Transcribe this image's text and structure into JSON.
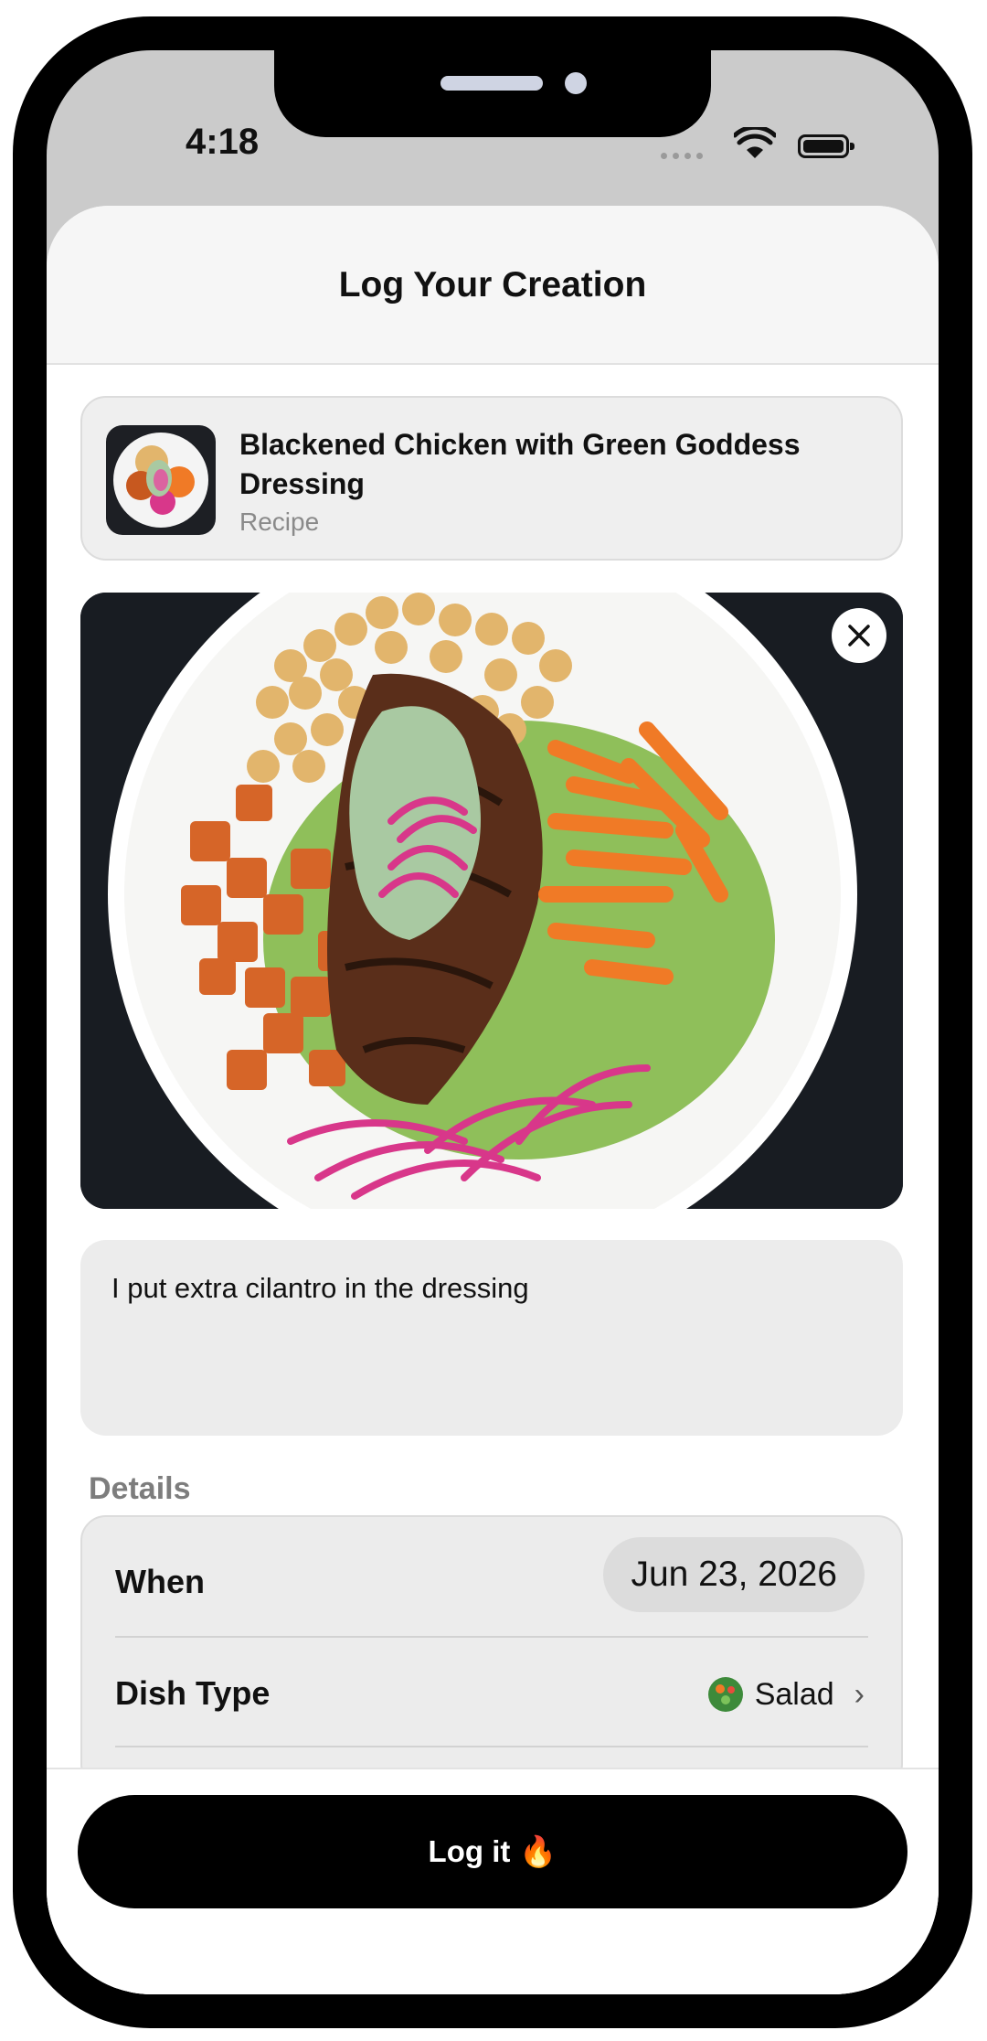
{
  "status_bar": {
    "time": "4:18"
  },
  "sheet": {
    "title": "Log Your Creation"
  },
  "recipe": {
    "title": "Blackened Chicken with Green Goddess Dressing",
    "subtitle": "Recipe"
  },
  "photo": {
    "close_icon": "close-icon"
  },
  "note": {
    "text": "I put extra cilantro in the dressing"
  },
  "details": {
    "section_label": "Details",
    "when_label": "When",
    "when_value": "Jun 23, 2026",
    "dish_type_label": "Dish Type",
    "dish_type_value": "Salad",
    "dish_type_chevron": "›"
  },
  "footer": {
    "button_label": "Log it",
    "button_emoji": "🔥"
  },
  "colors": {
    "button": "#000000",
    "card_bg": "#ececec",
    "muted_text": "#8a8a8a"
  }
}
